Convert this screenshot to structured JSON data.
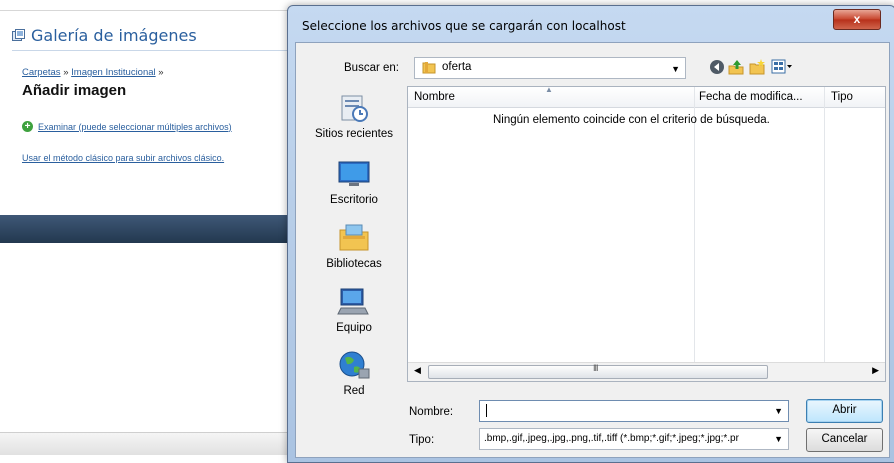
{
  "background": {
    "gallery_title": "Galería de imágenes",
    "breadcrumb": {
      "link1": "Carpetas",
      "sep1": "»",
      "link2": "Imagen Institucional",
      "sep2": "»"
    },
    "heading": "Añadir imagen",
    "browse_link": "Examinar (puede seleccionar múltiples archivos)",
    "classic_link": "Usar el método clásico para subir archivos clásico."
  },
  "dialog": {
    "title": "Seleccione los archivos que se cargarán con localhost",
    "close_label": "x",
    "lookin_label": "Buscar en:",
    "lookin_value": "oferta",
    "places": [
      {
        "label": "Sitios recientes",
        "icon": "recent-places-icon"
      },
      {
        "label": "Escritorio",
        "icon": "desktop-icon"
      },
      {
        "label": "Bibliotecas",
        "icon": "libraries-icon"
      },
      {
        "label": "Equipo",
        "icon": "computer-icon"
      },
      {
        "label": "Red",
        "icon": "network-icon"
      }
    ],
    "columns": {
      "name": "Nombre",
      "date": "Fecha de modifica...",
      "type": "Tipo"
    },
    "empty_message": "Ningún elemento coincide con el criterio de búsqueda.",
    "scroll_grip": "III",
    "filename_label": "Nombre:",
    "filename_value": "",
    "filetype_label": "Tipo:",
    "filetype_value": ".bmp,.gif,.jpeg,.jpg,.png,.tif,.tiff (*.bmp;*.gif;*.jpeg;*.jpg;*.pr",
    "open_button": "Abrir",
    "cancel_button": "Cancelar"
  },
  "colors": {
    "link": "#2a5f9e",
    "dialog_frame": "#b9cfe9",
    "close_button": "#c7432b"
  }
}
